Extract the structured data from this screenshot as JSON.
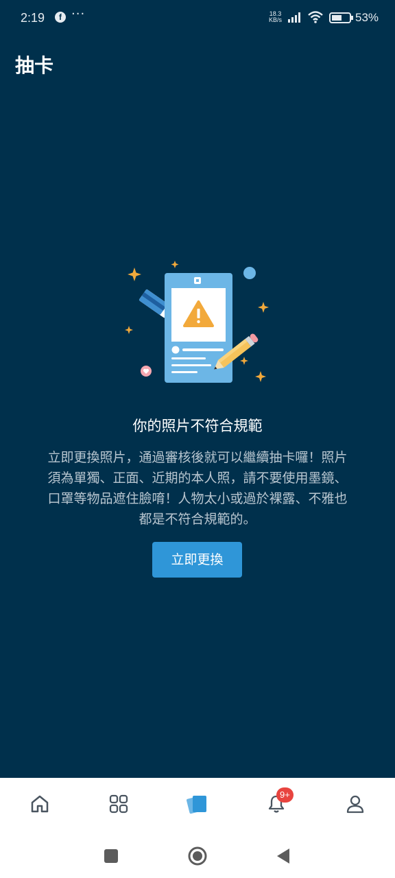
{
  "status_bar": {
    "time": "2:19",
    "fb_letter": "f",
    "more": "···",
    "net_speed_value": "18.3",
    "net_speed_unit": "KB/s",
    "battery_percent": "53%"
  },
  "header": {
    "title": "抽卡"
  },
  "main": {
    "heading": "你的照片不符合規範",
    "description": "立即更換照片，通過審核後就可以繼續抽卡囉！照片須為單獨、正面、近期的本人照，請不要使用墨鏡、口罩等物品遮住臉唷！人物太小或過於裸露、不雅也都是不符合規範的。",
    "cta_label": "立即更換"
  },
  "tab_bar": {
    "items": [
      {
        "icon": "home-icon",
        "active": false
      },
      {
        "icon": "grid-icon",
        "active": false
      },
      {
        "icon": "cards-icon",
        "active": true
      },
      {
        "icon": "bell-icon",
        "active": false,
        "badge": "9+"
      },
      {
        "icon": "profile-icon",
        "active": false
      }
    ]
  },
  "colors": {
    "background": "#00304c",
    "accent": "#2f96d8",
    "badge": "#e8443f",
    "tab_icon": "#4a5560",
    "warning": "#f2a93b"
  }
}
